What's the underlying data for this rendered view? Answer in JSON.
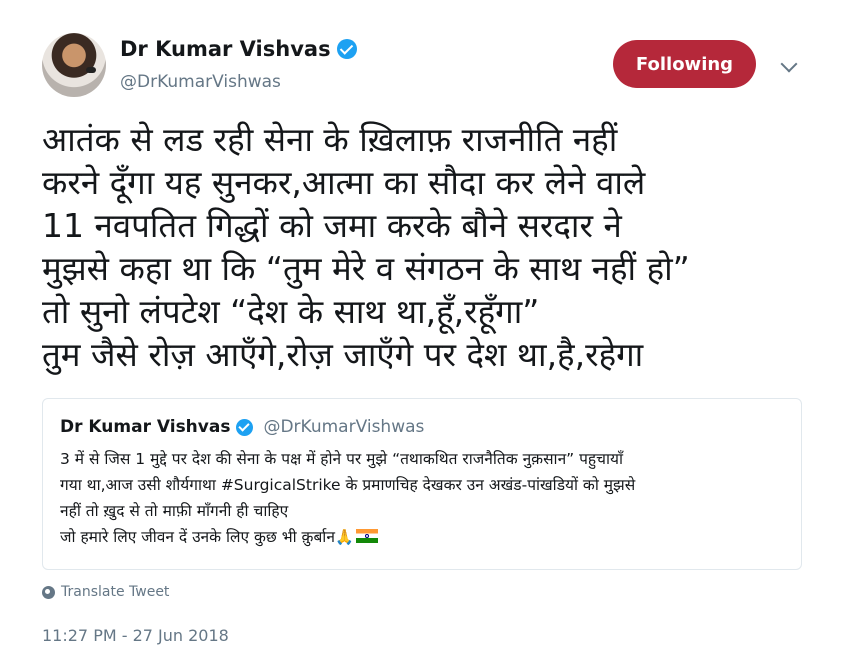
{
  "author": {
    "name": "Dr Kumar Vishvas",
    "handle": "@DrKumarVishwas",
    "follow_label": "Following"
  },
  "tweet": {
    "text": "आतंक से लड रही सेना के ख़िलाफ़ राजनीति नहीं\nकरने दूँगा यह सुनकर,आत्मा का सौदा कर लेने वाले\n11 नवपतित गिद्धों को जमा करके बौने सरदार ने\nमुझसे कहा था कि “तुम मेरे व संगठन के साथ नहीं हो”\nतो सुनो लंपटेश “देश के साथ था,हूँ,रहूँगा”\nतुम जैसे रोज़ आएँगे,रोज़ जाएँगे पर देश था,है,रहेगा",
    "translate_label": "Translate Tweet",
    "timestamp": "11:27 PM - 27 Jun 2018"
  },
  "quoted_tweet": {
    "name": "Dr Kumar Vishvas",
    "handle": "@DrKumarVishwas",
    "text": "3 में से जिस 1 मुद्दे पर देश की सेना के पक्ष में होने पर मुझे “तथाकथित राजनैतिक नुक़सान” पहुचायाँ\nगया था,आज उसी शौर्यगाथा #SurgicalStrike के प्रमाणचिह देखकर उन अखंड-पांखडियों को मुझसे\nनहीं तो ख़ुद से तो माफ़ी माँगनी ही चाहिए\nजो हमारे लिए जीवन दें उनके लिए कुछ भी क़ुर्बान",
    "emoji_hands": "🙏",
    "flag_icon": "india-flag-icon"
  },
  "icons": {
    "verified": "verified-badge-icon",
    "chevron": "chevron-down-icon",
    "globe": "globe-icon"
  },
  "colors": {
    "follow_button": "#b5283a",
    "verified": "#1da1f2",
    "secondary_text": "#657786"
  }
}
